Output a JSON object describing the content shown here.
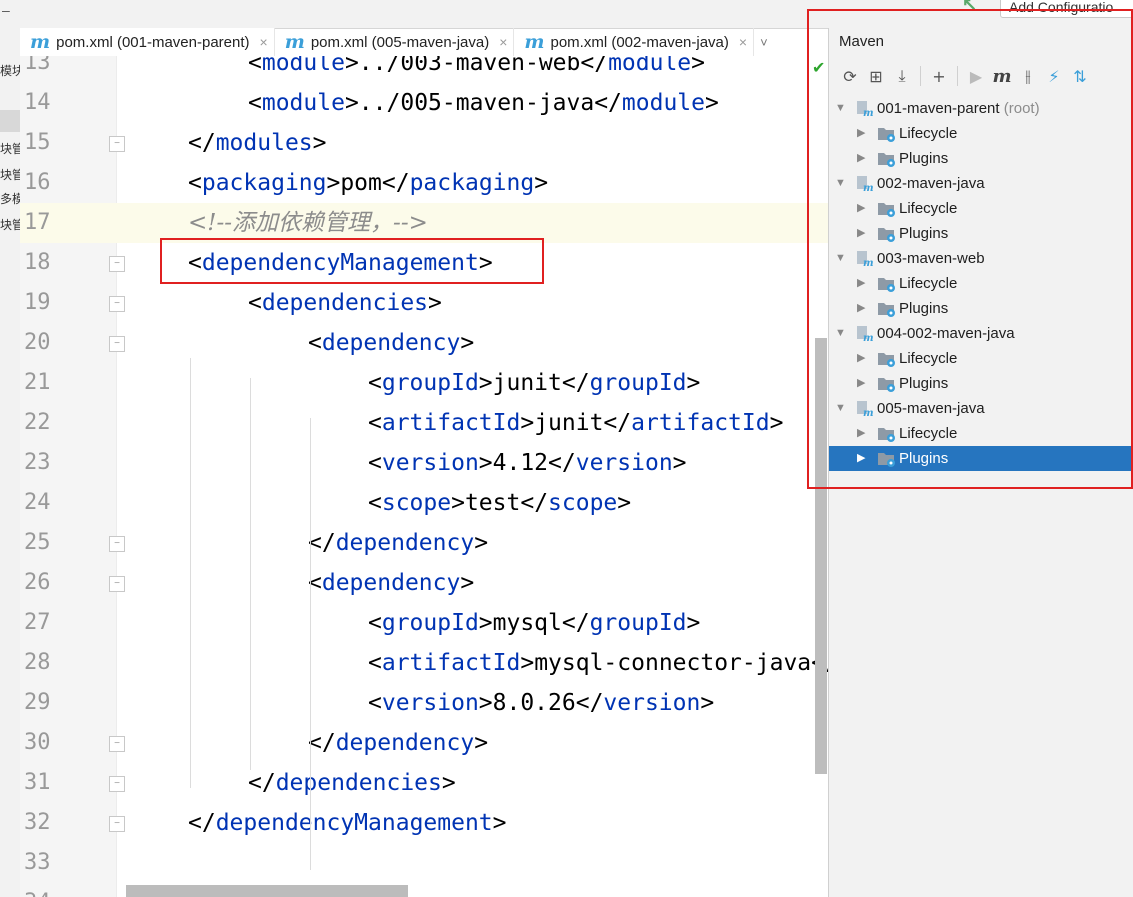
{
  "topbar": {
    "dash": "–",
    "run_config_label": "Add Configuratio"
  },
  "left_strip": [
    "模块",
    "块管",
    "块管",
    "多模",
    "块管"
  ],
  "tabs": [
    {
      "label": "pom.xml (001-maven-parent)",
      "active": true
    },
    {
      "label": "pom.xml (005-maven-java)",
      "active": false
    },
    {
      "label": "pom.xml (002-maven-java)",
      "active": false
    }
  ],
  "tabs_more": "˅",
  "editor": {
    "lines": [
      {
        "n": "13",
        "indent": 2,
        "parts": [
          [
            "br",
            "<"
          ],
          [
            "tag",
            "module"
          ],
          [
            "br",
            ">../003-maven-web</"
          ],
          [
            "tag",
            "module"
          ],
          [
            "br",
            ">"
          ]
        ]
      },
      {
        "n": "14",
        "indent": 2,
        "parts": [
          [
            "br",
            "<"
          ],
          [
            "tag",
            "module"
          ],
          [
            "br",
            ">../005-maven-java</"
          ],
          [
            "tag",
            "module"
          ],
          [
            "br",
            ">"
          ]
        ]
      },
      {
        "n": "15",
        "indent": 1,
        "parts": [
          [
            "br",
            "</"
          ],
          [
            "tag",
            "modules"
          ],
          [
            "br",
            ">"
          ]
        ]
      },
      {
        "n": "16",
        "indent": 1,
        "parts": [
          [
            "br",
            "<"
          ],
          [
            "tag",
            "packaging"
          ],
          [
            "br",
            ">pom</"
          ],
          [
            "tag",
            "packaging"
          ],
          [
            "br",
            ">"
          ]
        ]
      },
      {
        "n": "17",
        "indent": 1,
        "parts": [
          [
            "cmt",
            "<!--添加依赖管理，-->"
          ]
        ],
        "highlight": true
      },
      {
        "n": "18",
        "indent": 1,
        "parts": [
          [
            "br",
            "<"
          ],
          [
            "tag",
            "dependencyManagement"
          ],
          [
            "br",
            ">"
          ]
        ]
      },
      {
        "n": "19",
        "indent": 2,
        "parts": [
          [
            "br",
            "<"
          ],
          [
            "tag",
            "dependencies"
          ],
          [
            "br",
            ">"
          ]
        ]
      },
      {
        "n": "20",
        "indent": 3,
        "parts": [
          [
            "br",
            "<"
          ],
          [
            "tag",
            "dependency"
          ],
          [
            "br",
            ">"
          ]
        ]
      },
      {
        "n": "21",
        "indent": 4,
        "parts": [
          [
            "br",
            "<"
          ],
          [
            "tag",
            "groupId"
          ],
          [
            "br",
            ">junit</"
          ],
          [
            "tag",
            "groupId"
          ],
          [
            "br",
            ">"
          ]
        ]
      },
      {
        "n": "22",
        "indent": 4,
        "parts": [
          [
            "br",
            "<"
          ],
          [
            "tag",
            "artifactId"
          ],
          [
            "br",
            ">junit</"
          ],
          [
            "tag",
            "artifactId"
          ],
          [
            "br",
            ">"
          ]
        ]
      },
      {
        "n": "23",
        "indent": 4,
        "parts": [
          [
            "br",
            "<"
          ],
          [
            "tag",
            "version"
          ],
          [
            "br",
            ">4.12</"
          ],
          [
            "tag",
            "version"
          ],
          [
            "br",
            ">"
          ]
        ]
      },
      {
        "n": "24",
        "indent": 4,
        "parts": [
          [
            "br",
            "<"
          ],
          [
            "tag",
            "scope"
          ],
          [
            "br",
            ">test</"
          ],
          [
            "tag",
            "scope"
          ],
          [
            "br",
            ">"
          ]
        ]
      },
      {
        "n": "25",
        "indent": 3,
        "parts": [
          [
            "br",
            "</"
          ],
          [
            "tag",
            "dependency"
          ],
          [
            "br",
            ">"
          ]
        ]
      },
      {
        "n": "26",
        "indent": 3,
        "parts": [
          [
            "br",
            "<"
          ],
          [
            "tag",
            "dependency"
          ],
          [
            "br",
            ">"
          ]
        ]
      },
      {
        "n": "27",
        "indent": 4,
        "parts": [
          [
            "br",
            "<"
          ],
          [
            "tag",
            "groupId"
          ],
          [
            "br",
            ">mysql</"
          ],
          [
            "tag",
            "groupId"
          ],
          [
            "br",
            ">"
          ]
        ]
      },
      {
        "n": "28",
        "indent": 4,
        "parts": [
          [
            "br",
            "<"
          ],
          [
            "tag",
            "artifactId"
          ],
          [
            "br",
            ">mysql-connector-java</"
          ],
          [
            "tag",
            "artifactId"
          ],
          [
            "br",
            ">"
          ]
        ]
      },
      {
        "n": "29",
        "indent": 4,
        "parts": [
          [
            "br",
            "<"
          ],
          [
            "tag",
            "version"
          ],
          [
            "br",
            ">8.0.26</"
          ],
          [
            "tag",
            "version"
          ],
          [
            "br",
            ">"
          ]
        ]
      },
      {
        "n": "30",
        "indent": 3,
        "parts": [
          [
            "br",
            "</"
          ],
          [
            "tag",
            "dependency"
          ],
          [
            "br",
            ">"
          ]
        ]
      },
      {
        "n": "31",
        "indent": 2,
        "parts": [
          [
            "br",
            "</"
          ],
          [
            "tag",
            "dependencies"
          ],
          [
            "br",
            ">"
          ]
        ]
      },
      {
        "n": "32",
        "indent": 1,
        "parts": [
          [
            "br",
            "</"
          ],
          [
            "tag",
            "dependencyManagement"
          ],
          [
            "br",
            ">"
          ]
        ]
      },
      {
        "n": "33",
        "indent": 0,
        "parts": []
      },
      {
        "n": "34",
        "indent": 0,
        "parts": [
          [
            "br",
            "</"
          ],
          [
            "tag",
            "project"
          ],
          [
            "br",
            ">"
          ]
        ]
      }
    ]
  },
  "maven": {
    "title": "Maven",
    "toolbar": [
      {
        "icon": "reload-icon",
        "glyph": "⟳"
      },
      {
        "icon": "add-maven-project-icon",
        "glyph": "⊞"
      },
      {
        "icon": "download-icon",
        "glyph": "⤓"
      },
      {
        "sep": true
      },
      {
        "icon": "plus-icon",
        "glyph": "+"
      },
      {
        "sep": true
      },
      {
        "icon": "run-icon",
        "glyph": "▶"
      },
      {
        "icon": "execute-goal-icon",
        "glyph": "m"
      },
      {
        "icon": "toggle-offline-icon",
        "glyph": "⫲"
      },
      {
        "icon": "skip-tests-icon",
        "glyph": "⚡"
      },
      {
        "icon": "show-dependencies-icon",
        "glyph": "⇅"
      }
    ],
    "tree": [
      {
        "level": 0,
        "label": "001-maven-parent",
        "note": "(root)",
        "expanded": true,
        "type": "project"
      },
      {
        "level": 1,
        "label": "Lifecycle",
        "type": "folder"
      },
      {
        "level": 1,
        "label": "Plugins",
        "type": "folder"
      },
      {
        "level": 0,
        "label": "002-maven-java",
        "expanded": true,
        "type": "project"
      },
      {
        "level": 1,
        "label": "Lifecycle",
        "type": "folder"
      },
      {
        "level": 1,
        "label": "Plugins",
        "type": "folder"
      },
      {
        "level": 0,
        "label": "003-maven-web",
        "expanded": true,
        "type": "project"
      },
      {
        "level": 1,
        "label": "Lifecycle",
        "type": "folder"
      },
      {
        "level": 1,
        "label": "Plugins",
        "type": "folder"
      },
      {
        "level": 0,
        "label": "004-002-maven-java",
        "expanded": true,
        "type": "project"
      },
      {
        "level": 1,
        "label": "Lifecycle",
        "type": "folder"
      },
      {
        "level": 1,
        "label": "Plugins",
        "type": "folder"
      },
      {
        "level": 0,
        "label": "005-maven-java",
        "expanded": true,
        "type": "project"
      },
      {
        "level": 1,
        "label": "Lifecycle",
        "type": "folder"
      },
      {
        "level": 1,
        "label": "Plugins",
        "type": "folder",
        "selected": true
      }
    ]
  },
  "colors": {
    "tag": "#0033b3",
    "comment": "#8c8c8c",
    "selection": "#2675bf",
    "annotation_box": "#e02020",
    "maven_icon": "#3b9fd9"
  }
}
